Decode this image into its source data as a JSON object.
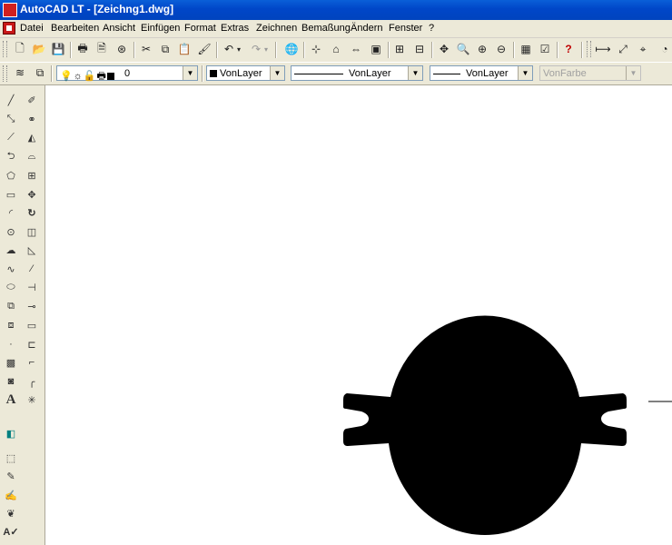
{
  "window": {
    "title": "AutoCAD LT - [Zeichng1.dwg]"
  },
  "menu": {
    "items": [
      "Datei",
      "Bearbeiten",
      "Ansicht",
      "Einfügen",
      "Format",
      "Extras",
      "Zeichnen",
      "Bemaßung",
      "Ändern",
      "Fenster",
      "?"
    ]
  },
  "layer_toolbar": {
    "layer_value": "0",
    "color_value": "VonLayer",
    "linetype_value": "VonLayer",
    "lineweight_value": "VonLayer",
    "plotstyle_value": "VonFarbe"
  }
}
